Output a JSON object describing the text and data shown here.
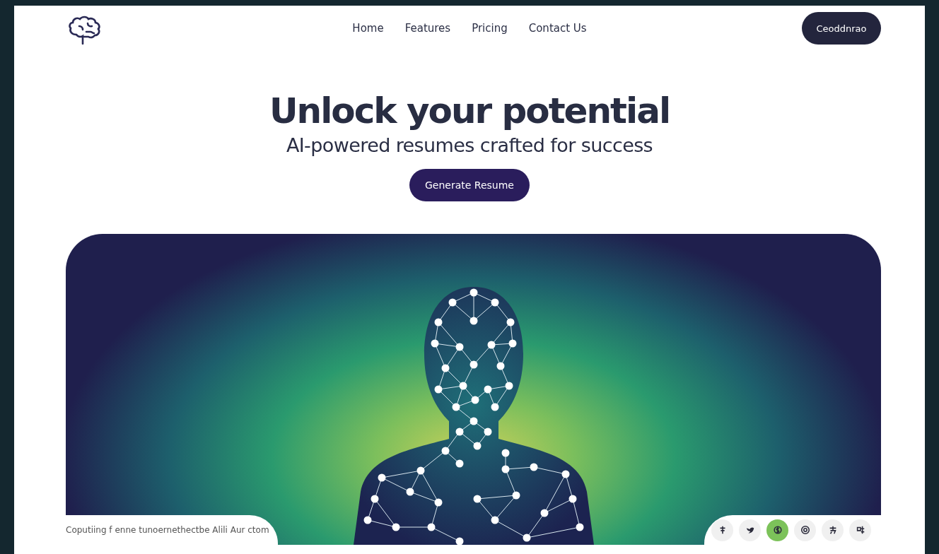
{
  "nav": {
    "links": [
      {
        "label": "Home"
      },
      {
        "label": "Features"
      },
      {
        "label": "Pricing"
      },
      {
        "label": "Contact Us"
      }
    ],
    "cta": "Ceoddnrao"
  },
  "hero": {
    "title": "Unlock your potential",
    "subtitle": "AI-powered resumes crafted for success",
    "button": "Generate Resume"
  },
  "footer": {
    "text": "Coputiing f enne tunoernethectbe Alili Aur ctom",
    "social_links": [
      {
        "kind": "pin",
        "selected": false
      },
      {
        "kind": "bird",
        "selected": false
      },
      {
        "kind": "coin",
        "selected": true
      },
      {
        "kind": "at",
        "selected": false
      },
      {
        "kind": "glyph",
        "selected": false
      },
      {
        "kind": "glyph2",
        "selected": false
      }
    ]
  }
}
